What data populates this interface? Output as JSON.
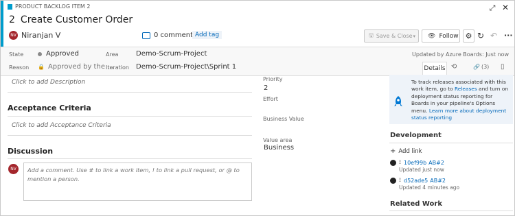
{
  "header": {
    "type_label": "PRODUCT BACKLOG ITEM 2",
    "id": "2",
    "title": "Create Customer Order",
    "assignee_initials": "NV",
    "assignee_name": "Niranjan V",
    "comments_label": "0 comments",
    "add_tag_label": "Add tag",
    "save_close_label": "Save & Close",
    "follow_label": "Follow"
  },
  "fields": {
    "state_label": "State",
    "state_value": "Approved",
    "reason_label": "Reason",
    "reason_value": "Approved by the ...",
    "area_label": "Area",
    "area_value": "Demo-Scrum-Project",
    "iteration_label": "Iteration",
    "iteration_value": "Demo-Scrum-Project\\Sprint 1",
    "updated_by": "Updated by Azure Boards: Just now"
  },
  "tabs": {
    "details_label": "Details",
    "links_count": "(3)"
  },
  "description": {
    "placeholder": "Click to add Description"
  },
  "acceptance": {
    "heading": "Acceptance Criteria",
    "placeholder": "Click to add Acceptance Criteria"
  },
  "discussion": {
    "heading": "Discussion",
    "avatar_initials": "NV",
    "comment_placeholder": "Add a comment. Use # to link a work item, ! to link a pull request, or @ to mention a person."
  },
  "planning": {
    "priority_label": "Priority",
    "priority_value": "2",
    "effort_label": "Effort",
    "business_value_label": "Business Value",
    "value_area_label": "Value area",
    "value_area_value": "Business"
  },
  "deployment": {
    "text_before": "To track releases associated with this work item, go to ",
    "releases_link": "Releases",
    "text_after": " and turn on deployment status reporting for Boards in your pipeline's Options menu. ",
    "learn_more_link": "Learn more about deployment status reporting"
  },
  "development": {
    "heading": "Development",
    "add_link_label": "Add link",
    "links": [
      {
        "commit": "10ef99b",
        "ref": "AB#2",
        "updated": "Updated just now"
      },
      {
        "commit": "d52ade5",
        "ref": "AB#2",
        "updated": "Updated 4 minutes ago"
      }
    ]
  },
  "related_work": {
    "heading": "Related Work"
  },
  "colors": {
    "accent": "#009ccc",
    "link": "#0067b8",
    "avatar": "#a4262c",
    "panel_bg": "#f8f8f8"
  }
}
